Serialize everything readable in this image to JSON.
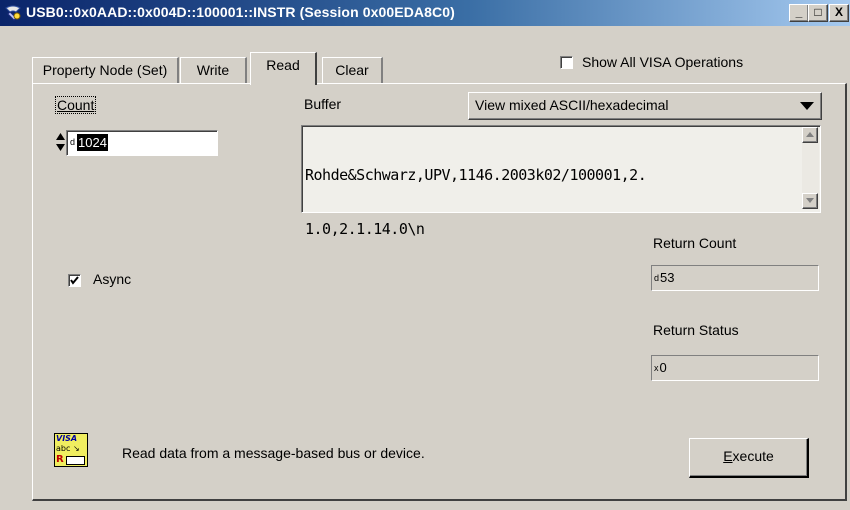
{
  "window": {
    "title": "USB0::0x0AAD::0x004D::100001::INSTR (Session 0x00EDA8C0)",
    "buttons": {
      "minimize": "_",
      "maximize": "□",
      "close": "X"
    }
  },
  "tabs": [
    {
      "label": "Property Node (Set)"
    },
    {
      "label": "Write"
    },
    {
      "label": "Read"
    },
    {
      "label": "Clear"
    }
  ],
  "active_tab": "Read",
  "show_all_visa": {
    "label": "Show All VISA Operations",
    "checked": false
  },
  "count": {
    "label": "Count",
    "radix": "d",
    "value": "1024"
  },
  "buffer": {
    "label": "Buffer",
    "view_mode": "View mixed ASCII/hexadecimal",
    "content_line1": "Rohde&Schwarz,UPV,1146.2003k02/100001,2.",
    "content_line2": "1.0,2.1.14.0\\n"
  },
  "async": {
    "label": "Async",
    "checked": true
  },
  "return_count": {
    "label": "Return Count",
    "radix": "d",
    "value": "53"
  },
  "return_status": {
    "label": "Return Status",
    "radix": "x",
    "value": "0"
  },
  "description": {
    "icon_text_top": "VISA",
    "icon_text_mid": "abc",
    "icon_text_bottom": "R",
    "text": "Read data from a message-based bus or device."
  },
  "execute_button": {
    "label_first": "E",
    "label_rest": "xecute"
  }
}
